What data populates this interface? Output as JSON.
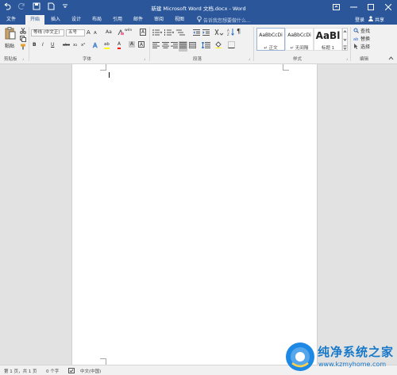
{
  "window": {
    "title": "新建 Microsoft Word 文档.docx - Word"
  },
  "qat": {
    "icons": [
      "undo-icon",
      "redo-icon",
      "save-icon",
      "new-icon",
      "customize-icon"
    ]
  },
  "tabs": [
    "文件",
    "开始",
    "插入",
    "设计",
    "布局",
    "引用",
    "邮件",
    "审阅",
    "视图"
  ],
  "active_tab": "开始",
  "tell_me": {
    "placeholder": "告诉我您想要做什么..."
  },
  "account": {
    "login": "登录",
    "share": "共享"
  },
  "clipboard": {
    "paste": "粘贴",
    "label": "剪贴板"
  },
  "font": {
    "name": "等线 (中文正)",
    "size": "五号",
    "grow": "A",
    "shrink": "A",
    "case": "Aa",
    "wen": "wén",
    "A_box": "A",
    "bold": "B",
    "italic": "I",
    "underline": "U",
    "strike": "abc",
    "sub": "x₂",
    "sup": "x²",
    "highlight": "ab",
    "color": "A",
    "char_shade": "A",
    "char_border": "A",
    "label": "字体"
  },
  "paragraph": {
    "label": "段落"
  },
  "styles": {
    "tiles": [
      {
        "sample": "AaBbCcDi",
        "name": "正文"
      },
      {
        "sample": "AaBbCcDi",
        "name": "无间隔"
      },
      {
        "sample": "AaBl",
        "name": "标题 1"
      }
    ],
    "label": "样式"
  },
  "editing": {
    "find": "查找",
    "replace": "替换",
    "select": "选择",
    "label": "编辑"
  },
  "status": {
    "page": "第 1 页，共 1 页",
    "words": "0 个字",
    "lang": "中文(中国)"
  },
  "watermark": {
    "title": "纯净系统之家",
    "url": "www.kzmyhome.com"
  },
  "colors": {
    "accent": "#2b579a",
    "highlight": "#ffff00",
    "font_color": "#ff0000"
  }
}
